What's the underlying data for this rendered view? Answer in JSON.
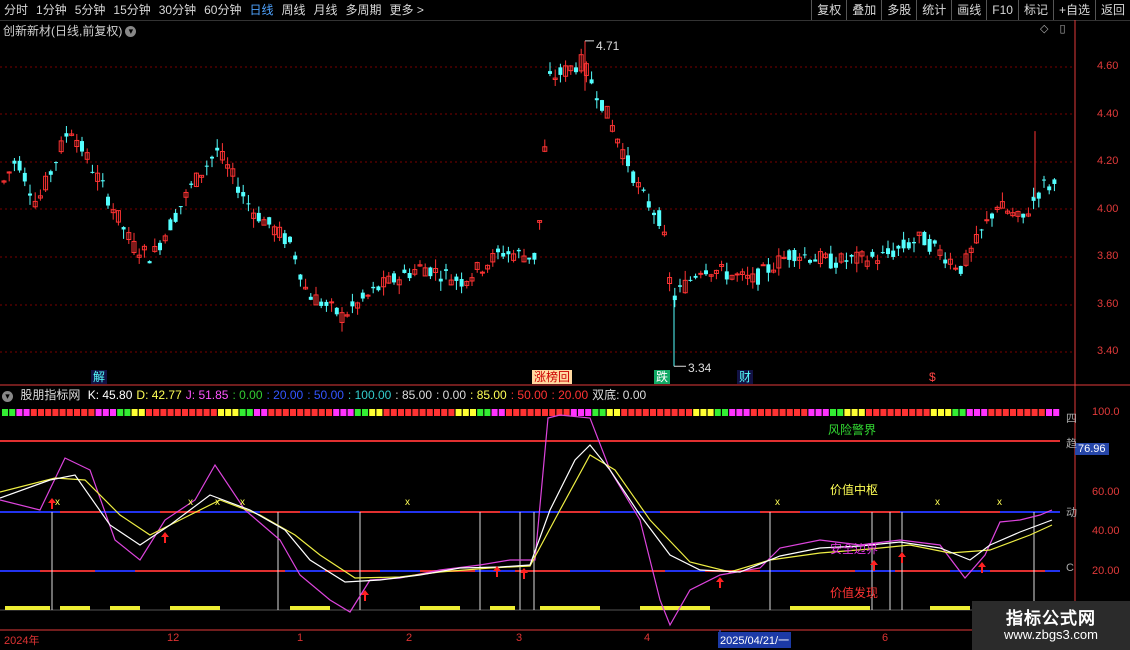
{
  "toolbar": {
    "periods": [
      "分时",
      "1分钟",
      "5分钟",
      "15分钟",
      "30分钟",
      "60分钟",
      "日线",
      "周线",
      "月线",
      "多周期",
      "更多 >"
    ],
    "active_period": "日线",
    "actions": [
      "复权",
      "叠加",
      "多股",
      "统计",
      "画线",
      "F10",
      "标记",
      "+自选",
      "返回"
    ]
  },
  "stock": {
    "name": "创新新材(日线,前复权)"
  },
  "price_axis": {
    "ticks": [
      "4.60",
      "4.40",
      "4.20",
      "4.00",
      "3.80",
      "3.60",
      "3.40"
    ]
  },
  "price_markers": {
    "high": "4.71",
    "low": "3.34"
  },
  "events": [
    "解",
    "涨榜回",
    "跌",
    "财",
    "$"
  ],
  "indicator": {
    "name": "股朋指标网",
    "values": [
      {
        "text": "K: 45.80",
        "color": "#ffffff"
      },
      {
        "text": "D: 42.77",
        "color": "#ffff55"
      },
      {
        "text": "J: 51.85",
        "color": "#ff55ff"
      },
      {
        "text": ": 0.00",
        "color": "#33cc33"
      },
      {
        "text": ": 20.00",
        "color": "#3355ff"
      },
      {
        "text": ": 50.00",
        "color": "#3355ff"
      },
      {
        "text": ": 100.00",
        "color": "#33cccc"
      },
      {
        "text": ": 85.00",
        "color": "#dddddd"
      },
      {
        "text": ": 0.00",
        "color": "#dddddd"
      },
      {
        "text": ": 85.00",
        "color": "#ffff55"
      },
      {
        "text": ": 50.00",
        "color": "#ff3333"
      },
      {
        "text": ": 20.00",
        "color": "#ff3333"
      },
      {
        "text": "双底: 0.00",
        "color": "#dddddd"
      }
    ],
    "axis_ticks": [
      "100.0",
      "60.00",
      "40.00",
      "20.00"
    ],
    "current_value": "76.96",
    "right_tags": [
      "四",
      "趋",
      "动",
      "C"
    ],
    "zones": [
      "风险警界",
      "价值中枢",
      "安全边界",
      "价值发现"
    ]
  },
  "date_axis": {
    "labels": [
      "2024年",
      "12",
      "1",
      "2",
      "3",
      "4",
      "2025/04/21/一",
      "6"
    ]
  },
  "watermark": {
    "title": "指标公式网",
    "url": "www.zbgs3.com"
  },
  "colors": {
    "up": "#ff3333",
    "down": "#54ffff",
    "grid": "#7a0000",
    "axis": "#e23a3a"
  }
}
